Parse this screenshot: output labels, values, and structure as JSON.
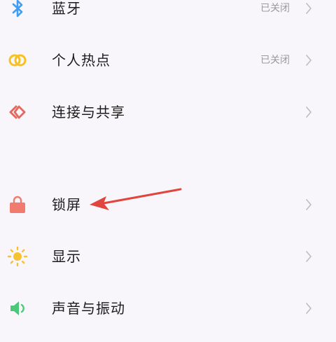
{
  "settings": {
    "items": [
      {
        "label": "蓝牙",
        "status": "已关闭",
        "icon": "bluetooth-icon",
        "color": "#3e9ef5"
      },
      {
        "label": "个人热点",
        "status": "已关闭",
        "icon": "hotspot-icon",
        "color": "#f5c220"
      },
      {
        "label": "连接与共享",
        "status": "",
        "icon": "connection-share-icon",
        "color": "#e5685e"
      },
      {
        "label": "锁屏",
        "status": "",
        "icon": "lock-icon",
        "color": "#f07b6e"
      },
      {
        "label": "显示",
        "status": "",
        "icon": "sun-icon",
        "color": "#f6c232"
      },
      {
        "label": "声音与振动",
        "status": "",
        "icon": "speaker-icon",
        "color": "#4cc978"
      }
    ]
  },
  "annotation": {
    "color": "#e0463e"
  }
}
